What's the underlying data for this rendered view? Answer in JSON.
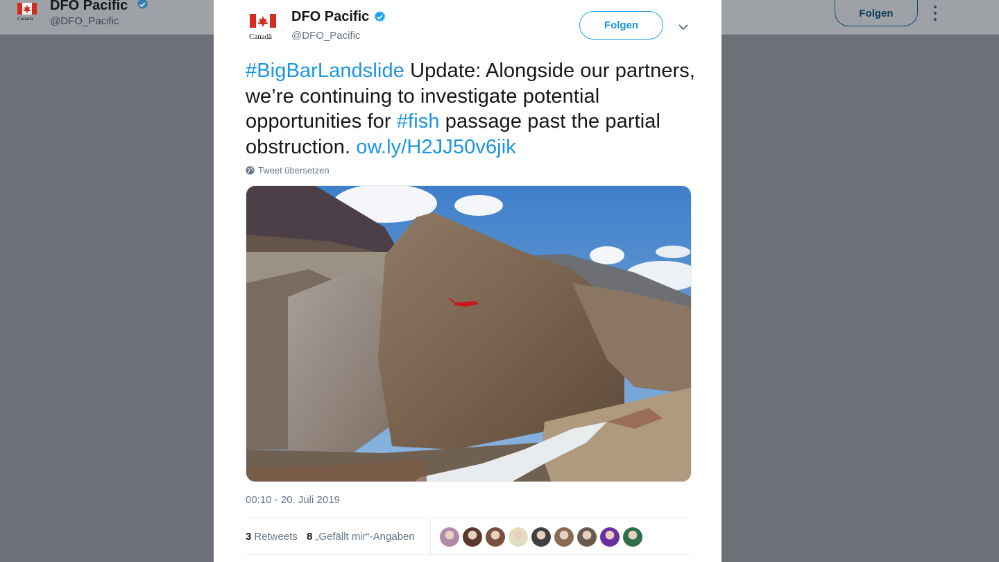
{
  "background_header": {
    "name": "DFO Pacific",
    "handle": "@DFO_Pacific",
    "follow_label": "Folgen",
    "logo_text": "Canada"
  },
  "tweet": {
    "author": {
      "name": "DFO Pacific",
      "handle": "@DFO_Pacific",
      "verified": true,
      "avatar_text": "Canadä"
    },
    "follow_label": "Folgen",
    "text": {
      "hashtag1": "#BigBarLandslide",
      "part1": " Update: Alongside our partners, we’re continuing to investigate potential opportunities for ",
      "hashtag2": "#fish",
      "part2": " passage past the partial obstruction. ",
      "link": "ow.ly/H2JJ50v6jik"
    },
    "translate_label": "Tweet übersetzen",
    "timestamp": "00:10 - 20. Juli 2019",
    "retweets": {
      "count": "3",
      "label": "Retweets"
    },
    "likes": {
      "count": "8",
      "label": "„Gefällt mir“-Angaben"
    },
    "liker_avatar_colors": [
      "#b08aa8",
      "#5a3a30",
      "#7a5040",
      "#e2dcc0",
      "#404040",
      "#8a6a50",
      "#6a5a50",
      "#6a2fa0",
      "#2e6e4a"
    ]
  },
  "colors": {
    "accent": "#1da1f2",
    "link": "#1b95e0",
    "muted": "#657786",
    "flag_red": "#d52b1e"
  },
  "icons": {
    "verified": "verified-badge-icon",
    "caret": "chevron-down-icon",
    "globe": "globe-icon",
    "more": "more-vertical-icon"
  }
}
